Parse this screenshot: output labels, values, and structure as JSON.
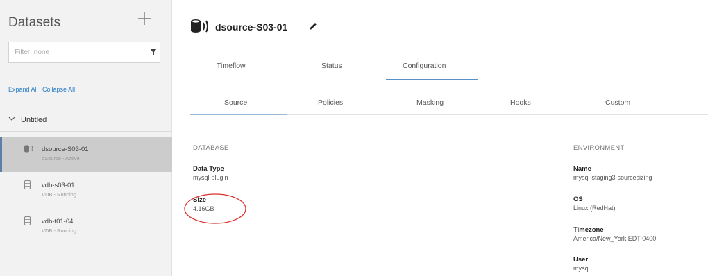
{
  "sidebar": {
    "title": "Datasets",
    "filter_placeholder": "Filter: none",
    "expand_all": "Expand All",
    "collapse_all": "Collapse All",
    "group_label": "Untitled",
    "items": [
      {
        "name": "dsource-S03-01",
        "status": "dSource - Active",
        "icon": "database-sound-icon"
      },
      {
        "name": "vdb-s03-01",
        "status": "VDB - Running",
        "icon": "database-icon"
      },
      {
        "name": "vdb-t01-04",
        "status": "VDB - Running",
        "icon": "database-icon"
      }
    ]
  },
  "main": {
    "title": "dsource-S03-01",
    "tabs": [
      {
        "label": "Timeflow"
      },
      {
        "label": "Status"
      },
      {
        "label": "Configuration"
      }
    ],
    "active_tab": "Configuration",
    "subtabs": [
      {
        "label": "Source"
      },
      {
        "label": "Policies"
      },
      {
        "label": "Masking"
      },
      {
        "label": "Hooks"
      },
      {
        "label": "Custom"
      }
    ],
    "active_subtab": "Source",
    "database": {
      "heading": "DATABASE",
      "data_type_label": "Data Type",
      "data_type_value": "mysql-plugin",
      "size_label": "Size",
      "size_value": "4.16GB"
    },
    "environment": {
      "heading": "ENVIRONMENT",
      "name_label": "Name",
      "name_value": "mysql-staging3-sourcesizing",
      "os_label": "OS",
      "os_value": "Linux (RedHat)",
      "timezone_label": "Timezone",
      "timezone_value": "America/New_York,EDT-0400",
      "user_label": "User",
      "user_value": "mysql"
    }
  },
  "colors": {
    "accent": "#5a90c7",
    "sidebar_bg": "#f2f2f2",
    "active_item_bg": "#cccccc",
    "annotation": "#d9302c",
    "link": "#2d80c8"
  }
}
